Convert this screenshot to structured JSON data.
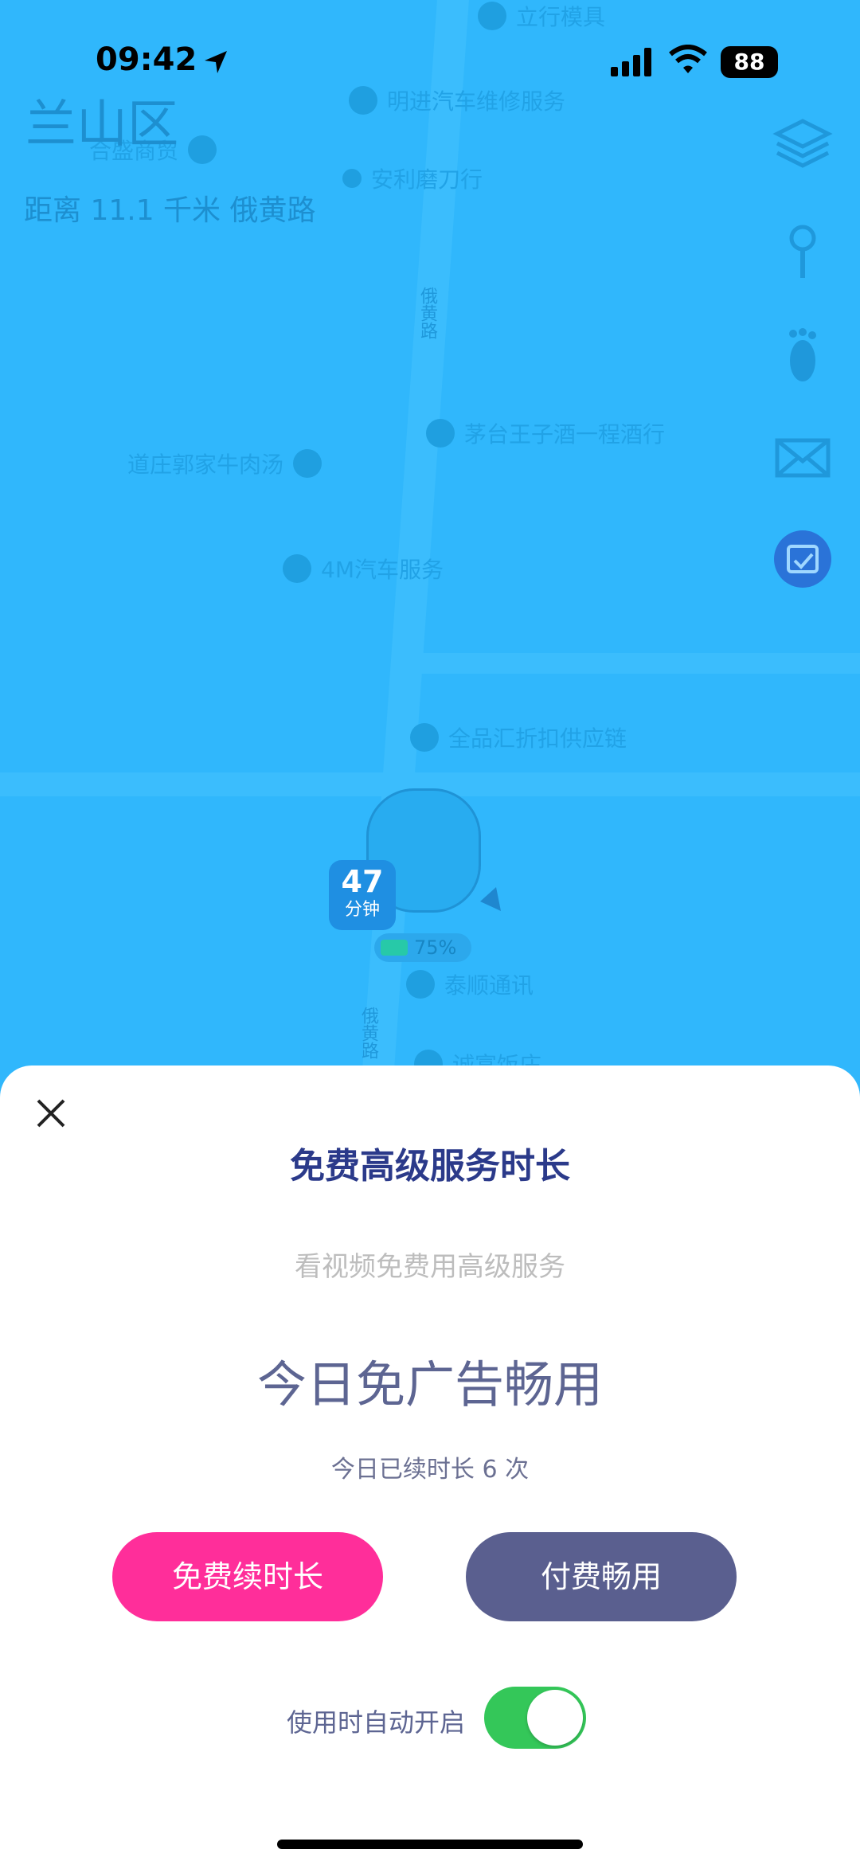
{
  "status_bar": {
    "time": "09:42",
    "battery": "88"
  },
  "map": {
    "district": "兰山区",
    "distance_text": "距离 11.1 千米 俄黄路",
    "road_label": "俄黄路",
    "pois": [
      "立行模具",
      "明进汽车维修服务",
      "合盛商贸",
      "安利磨刀行",
      "茅台王子酒一程酒行",
      "道庄郭家牛肉汤",
      "4M汽车服务",
      "全品汇折扣供应链",
      "泰顺通讯",
      "诚富饭庄"
    ],
    "eta": {
      "number": "47",
      "unit": "分钟"
    },
    "battery_percent": "75%"
  },
  "sheet": {
    "title": "免费高级服务时长",
    "subtitle": "看视频免费用高级服务",
    "headline": "今日免广告畅用",
    "count_text": "今日已续时长 6 次",
    "free_button": "免费续时长",
    "paid_button": "付费畅用",
    "auto_open_label": "使用时自动开启",
    "auto_open_enabled": true
  },
  "colors": {
    "map_blue": "#2eb6fb",
    "title": "#2b3a8a",
    "free_button": "#ff2e9a",
    "paid_button": "#5a5f8f",
    "toggle_on": "#34c759"
  }
}
